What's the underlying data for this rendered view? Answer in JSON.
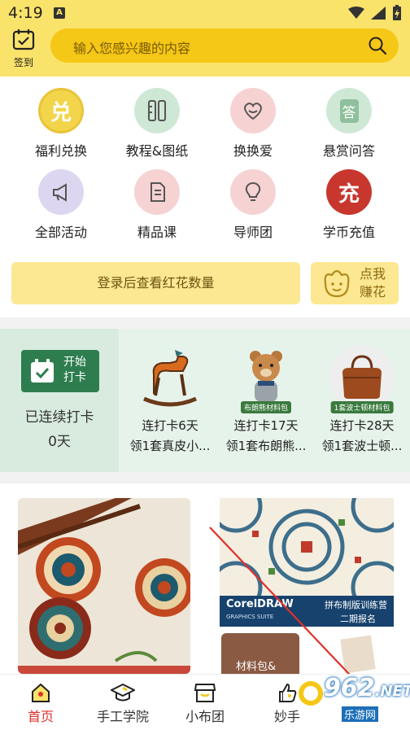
{
  "status": {
    "time": "4:19",
    "app_badge": "A"
  },
  "header": {
    "checkin_label": "签到",
    "search_placeholder": "输入您感兴趣的内容",
    "icons": [
      "calendar-check-icon",
      "search-icon"
    ]
  },
  "grid": [
    {
      "label": "福利兑换",
      "glyph": "兑",
      "color": "#f2d54a"
    },
    {
      "label": "教程&图纸",
      "glyph": "",
      "color": "#cfe8d6"
    },
    {
      "label": "换换爱",
      "glyph": "",
      "color": "#f6d2d2"
    },
    {
      "label": "悬赏问答",
      "glyph": "答",
      "color": "#cfe8d6"
    },
    {
      "label": "全部活动",
      "glyph": "",
      "color": "#ddd6f0"
    },
    {
      "label": "精品课",
      "glyph": "",
      "color": "#f6d2d2"
    },
    {
      "label": "导师团",
      "glyph": "",
      "color": "#f6d2d2"
    },
    {
      "label": "学币充值",
      "glyph": "充",
      "color": "#c8372d"
    }
  ],
  "login_banner": "登录后查看红花数量",
  "flower_button": {
    "line1": "点我",
    "line2": "赚花"
  },
  "checkin_strip": {
    "start_line1": "开始",
    "start_line2": "打卡",
    "streak_line1": "已连续打卡",
    "streak_line2": "0天",
    "rewards": [
      {
        "days": "连打卡6天",
        "gift": "领1套真皮小...",
        "tag": ""
      },
      {
        "days": "连打卡17天",
        "gift": "领1套布朗熊...",
        "tag": "布朗熊材料包"
      },
      {
        "days": "连打卡28天",
        "gift": "领1套波士顿...",
        "tag": "1套波士顿材料包"
      }
    ]
  },
  "feed": {
    "coreldraw_title": "CorelDRAW",
    "coreldraw_sub": "GRAPHICS SUITE",
    "course_line1": "拼布制版训练营",
    "course_line2": "二期报名",
    "card3_text": "材料包&"
  },
  "bottom_nav": [
    {
      "label": "首页",
      "active": true
    },
    {
      "label": "手工学院",
      "active": false
    },
    {
      "label": "小布团",
      "active": false
    },
    {
      "label": "妙手",
      "active": false
    }
  ],
  "watermark": {
    "number": "962",
    "suffix": ".NET",
    "site": "乐游网"
  }
}
